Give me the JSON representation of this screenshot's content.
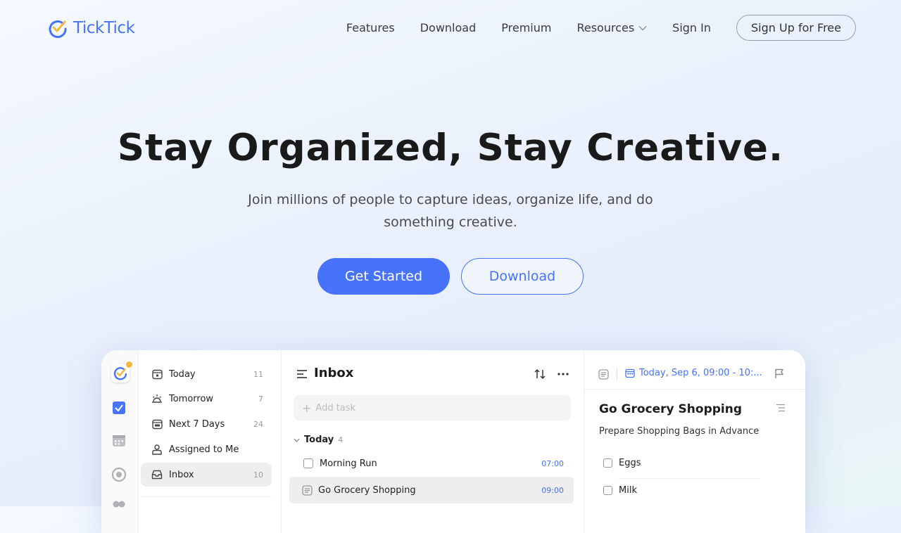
{
  "nav": {
    "brand": "TickTick",
    "links": [
      "Features",
      "Download",
      "Premium",
      "Resources",
      "Sign In"
    ],
    "signup": "Sign Up for Free"
  },
  "hero": {
    "title": "Stay Organized, Stay Creative.",
    "subtitle": "Join millions of people to capture ideas, organize life, and do something creative.",
    "primary_cta": "Get Started",
    "secondary_cta": "Download"
  },
  "app": {
    "lists": [
      {
        "label": "Today",
        "count": "11",
        "icon": "calendar-today-icon"
      },
      {
        "label": "Tomorrow",
        "count": "7",
        "icon": "sunrise-icon"
      },
      {
        "label": "Next 7 Days",
        "count": "24",
        "icon": "calendar-week-icon"
      },
      {
        "label": "Assigned to Me",
        "count": "",
        "icon": "person-icon"
      },
      {
        "label": "Inbox",
        "count": "10",
        "icon": "inbox-icon"
      }
    ],
    "inbox_title": "Inbox",
    "add_task_placeholder": "Add task",
    "section_label": "Today",
    "section_count": "4",
    "tasks": [
      {
        "title": "Morning Run",
        "time": "07:00"
      },
      {
        "title": "Go Grocery Shopping",
        "time": "09:00"
      }
    ],
    "detail": {
      "date": "Today, Sep 6, 09:00 - 10:...",
      "title": "Go Grocery Shopping",
      "subtitle": "Prepare Shopping Bags in Advance",
      "checklist": [
        "Eggs",
        "Milk"
      ]
    }
  },
  "colors": {
    "accent": "#4772fa",
    "badge": "#f6b73c"
  }
}
